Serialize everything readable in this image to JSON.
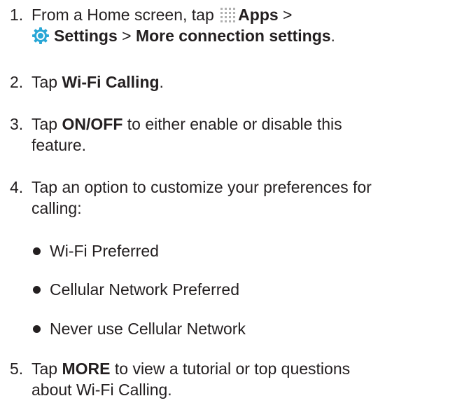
{
  "steps": [
    {
      "number": "1.",
      "before": "From a Home screen, tap ",
      "apps_label": "Apps",
      "sep1": " >",
      "settings_label": "Settings",
      "sep2": " > ",
      "more_label": "More connection settings",
      "end": ".",
      "apps_icon": "apps-grid-icon",
      "settings_icon": "settings-gear-icon"
    },
    {
      "number": "2.",
      "before": "Tap ",
      "bold": "Wi-Fi Calling",
      "after": "."
    },
    {
      "number": "3.",
      "before": "Tap ",
      "bold": "ON/OFF",
      "after": " to either enable or disable this",
      "line2": "feature."
    },
    {
      "number": "4.",
      "line1": "Tap an option to customize your preferences for",
      "line2": "calling:",
      "bullets": [
        "Wi-Fi Preferred",
        "Cellular Network Preferred",
        "Never use Cellular Network"
      ]
    },
    {
      "number": "5.",
      "before": "Tap ",
      "bold": "MORE",
      "after": " to view a tutorial or top questions",
      "line2": "about Wi-Fi Calling."
    }
  ],
  "colors": {
    "text": "#231f20",
    "apps_icon": "#b0b0b0",
    "settings_icon": "#2aa7d6"
  }
}
